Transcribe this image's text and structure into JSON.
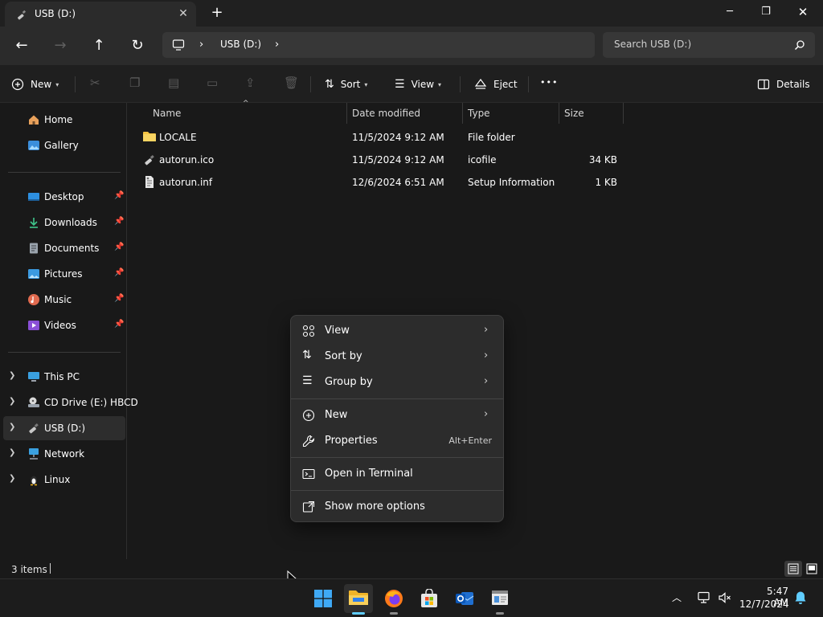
{
  "window": {
    "tab_title": "USB (D:)",
    "tab_close": "✕",
    "new_tab": "+",
    "minimize": "─",
    "restore": "❐",
    "close": "✕"
  },
  "nav": {
    "back": "←",
    "forward": "→",
    "up": "↑",
    "refresh": "↻",
    "breadcrumb": [
      "USB (D:)"
    ],
    "search_placeholder": "Search USB (D:)"
  },
  "commandbar": {
    "new_label": "New",
    "sort_label": "Sort",
    "view_label": "View",
    "eject_label": "Eject",
    "more_label": "•••",
    "details_label": "Details"
  },
  "sidebar": {
    "home": "Home",
    "gallery": "Gallery",
    "desktop": "Desktop",
    "downloads": "Downloads",
    "documents": "Documents",
    "pictures": "Pictures",
    "music": "Music",
    "videos": "Videos",
    "this_pc": "This PC",
    "cd_drive": "CD Drive (E:) HBCD",
    "usb": "USB (D:)",
    "network": "Network",
    "linux": "Linux"
  },
  "columns": {
    "name": "Name",
    "date": "Date modified",
    "type": "Type",
    "size": "Size"
  },
  "files": [
    {
      "name": "LOCALE",
      "date": "11/5/2024 9:12 AM",
      "type": "File folder",
      "size": "",
      "icon": "folder-icon"
    },
    {
      "name": "autorun.ico",
      "date": "11/5/2024 9:12 AM",
      "type": "icofile",
      "size": "34 KB",
      "icon": "ico-file-icon"
    },
    {
      "name": "autorun.inf",
      "date": "12/6/2024 6:51 AM",
      "type": "Setup Information",
      "size": "1 KB",
      "icon": "inf-file-icon"
    }
  ],
  "context_menu": {
    "view": "View",
    "sort_by": "Sort by",
    "group_by": "Group by",
    "new": "New",
    "properties": "Properties",
    "properties_shortcut": "Alt+Enter",
    "open_terminal": "Open in Terminal",
    "more_options": "Show more options"
  },
  "status": {
    "item_count": "3 items"
  },
  "taskbar": {
    "time": "5:47 AM",
    "date": "12/7/2024"
  },
  "colors": {
    "accent": "#60cdff",
    "folder": "#f5c342",
    "background": "#191919"
  }
}
